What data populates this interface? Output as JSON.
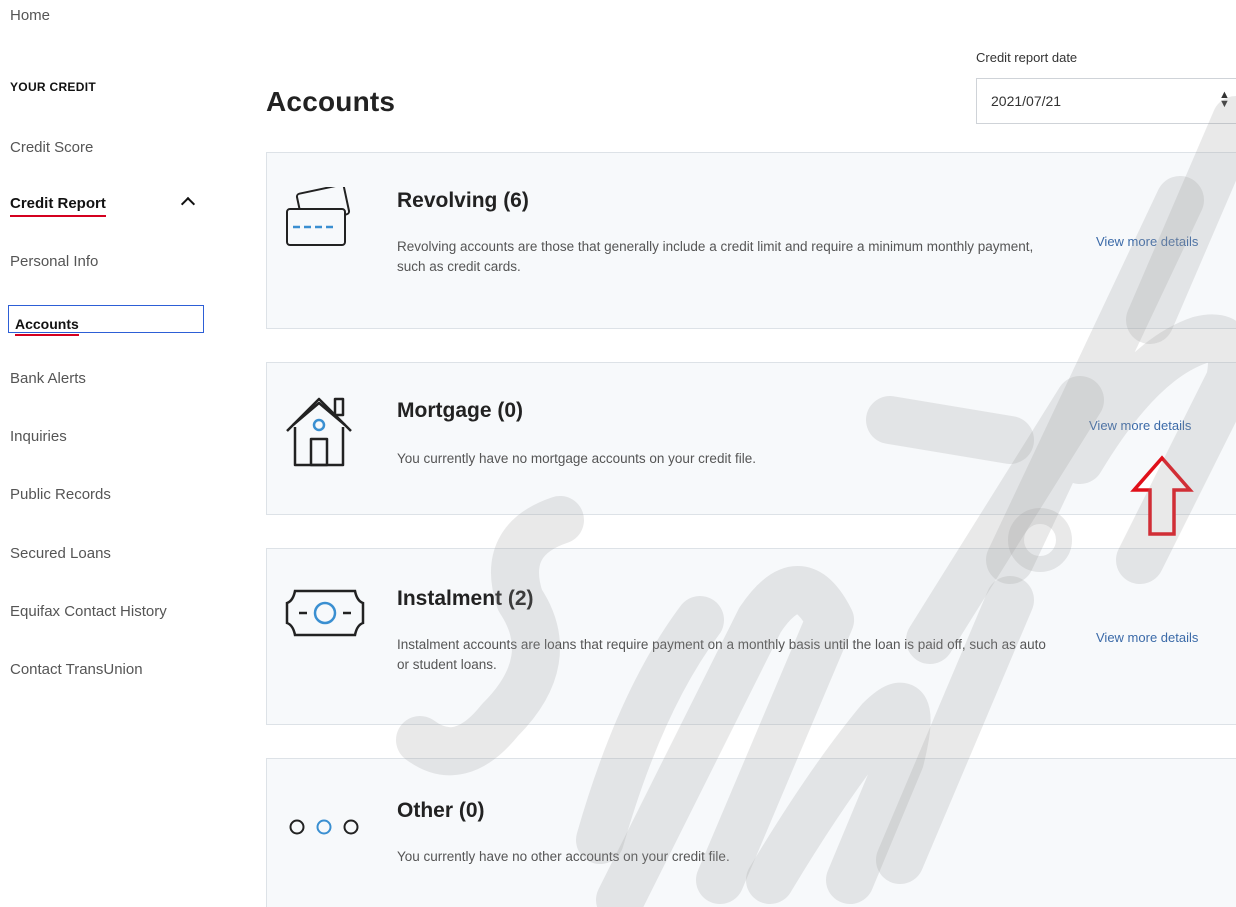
{
  "sidebar": {
    "home": "Home",
    "section_heading": "YOUR CREDIT",
    "items": [
      {
        "label": "Credit Score"
      },
      {
        "label": "Credit Report"
      },
      {
        "label": "Personal Info"
      },
      {
        "label": "Accounts"
      },
      {
        "label": "Bank Alerts"
      },
      {
        "label": "Inquiries"
      },
      {
        "label": "Public Records"
      },
      {
        "label": "Secured Loans"
      },
      {
        "label": "Equifax Contact History"
      },
      {
        "label": "Contact TransUnion"
      }
    ],
    "active_item": "Accounts",
    "accent_color": "#d4001f"
  },
  "header": {
    "title": "Accounts",
    "date_label": "Credit report date",
    "date_value": "2021/07/21"
  },
  "cards": [
    {
      "icon": "credit-card-icon",
      "title": "Revolving (6)",
      "description": "Revolving accounts are those that generally include a credit limit and require a minimum monthly payment, such as credit cards.",
      "link": "View more details"
    },
    {
      "icon": "house-icon",
      "title": "Mortgage (0)",
      "description": "You currently have no mortgage accounts on your credit file.",
      "link": "View more details"
    },
    {
      "icon": "money-bill-icon",
      "title": "Instalment (2)",
      "description": "Instalment accounts are loans that require payment on a monthly basis until the loan is paid off, such as auto or student loans.",
      "link": "View more details"
    },
    {
      "icon": "three-circles-icon",
      "title": "Other (0)",
      "description": "You currently have no other accounts on your credit file."
    }
  ],
  "colors": {
    "link": "#3b6aa8",
    "icon_accent": "#3a8fd1",
    "card_bg": "#f7f9fb",
    "annotation_arrow": "#e0101a"
  }
}
